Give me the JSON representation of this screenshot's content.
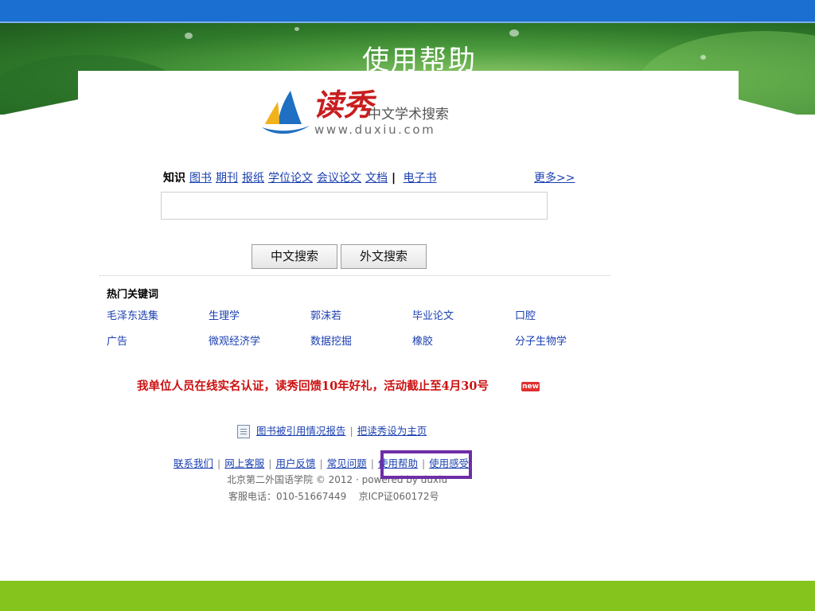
{
  "slide": {
    "title": "使用帮助"
  },
  "logo": {
    "brand": "读秀",
    "subtitle": "中文学术搜索",
    "url": "www.duxiu.com"
  },
  "tabs": [
    {
      "label": "知识",
      "active": true
    },
    {
      "label": "图书"
    },
    {
      "label": "期刊"
    },
    {
      "label": "报纸"
    },
    {
      "label": "学位论文"
    },
    {
      "label": "会议论文"
    },
    {
      "label": "文档"
    },
    {
      "label": "电子书"
    }
  ],
  "tabs_more": "更多>>",
  "search": {
    "value": "",
    "placeholder": ""
  },
  "buttons": {
    "chinese_search": "中文搜索",
    "foreign_search": "外文搜索"
  },
  "hot_keywords": {
    "title": "热门关键词",
    "rows": [
      [
        "毛泽东选集",
        "生理学",
        "郭沫若",
        "毕业论文",
        "口腔"
      ],
      [
        "广告",
        "微观经济学",
        "数据挖掘",
        "橡胶",
        "分子生物学"
      ]
    ]
  },
  "notice": {
    "text": "我单位人员在线实名认证，读秀回馈10年好礼，活动截止至4月30号",
    "badge": "new"
  },
  "report_links": {
    "citation_report": "图书被引用情况报告",
    "set_homepage": "把读秀设为主页"
  },
  "footer": {
    "links": [
      "联系我们",
      "网上客服",
      "用户反馈",
      "常见问题",
      "使用帮助",
      "使用感受"
    ],
    "copyright": "北京第二外国语学院 © 2012 · powered by duxiu",
    "phone": "客服电话：010-51667449",
    "icp": "京ICP证060172号"
  },
  "colors": {
    "top_bar": "#1a6fd0",
    "bottom_bar": "#85c41c",
    "highlight_box": "#6f2da8",
    "link": "#1a3fb0",
    "notice": "#cc1111"
  }
}
